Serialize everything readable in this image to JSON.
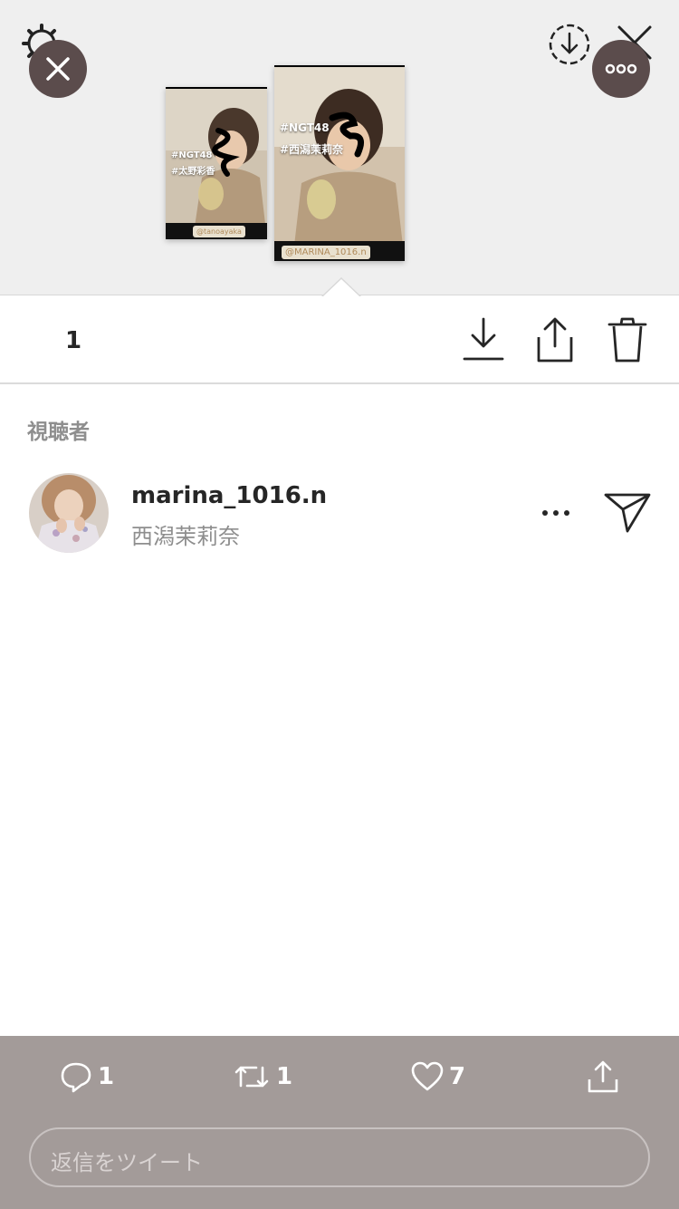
{
  "preview": {
    "small_story": {
      "tags": [
        "#NGT48",
        "#太野彩香"
      ],
      "credit": "@tanoayaka"
    },
    "big_story": {
      "tags": [
        "#NGT48",
        "#西潟茉莉奈"
      ],
      "credit": "@MARINA_1016.n"
    }
  },
  "stats": {
    "view_count": "1"
  },
  "viewers_section": {
    "title": "視聴者",
    "items": [
      {
        "username": "marina_1016.n",
        "full_name": "西潟茉莉奈"
      }
    ]
  },
  "tweet_bar": {
    "reply_count": "1",
    "retweet_count": "1",
    "like_count": "7",
    "reply_placeholder": "返信をツイート"
  },
  "colors": {
    "fab": "#5b4c4c",
    "bottom_bar": "#a39b99",
    "muted_text": "#8e8e8e"
  },
  "icons": [
    "gear-icon",
    "download-circle-icon",
    "close-icon",
    "more-icon",
    "eye-icon",
    "download-icon",
    "share-icon",
    "trash-icon",
    "send-icon",
    "reply-icon",
    "retweet-icon",
    "heart-icon"
  ]
}
